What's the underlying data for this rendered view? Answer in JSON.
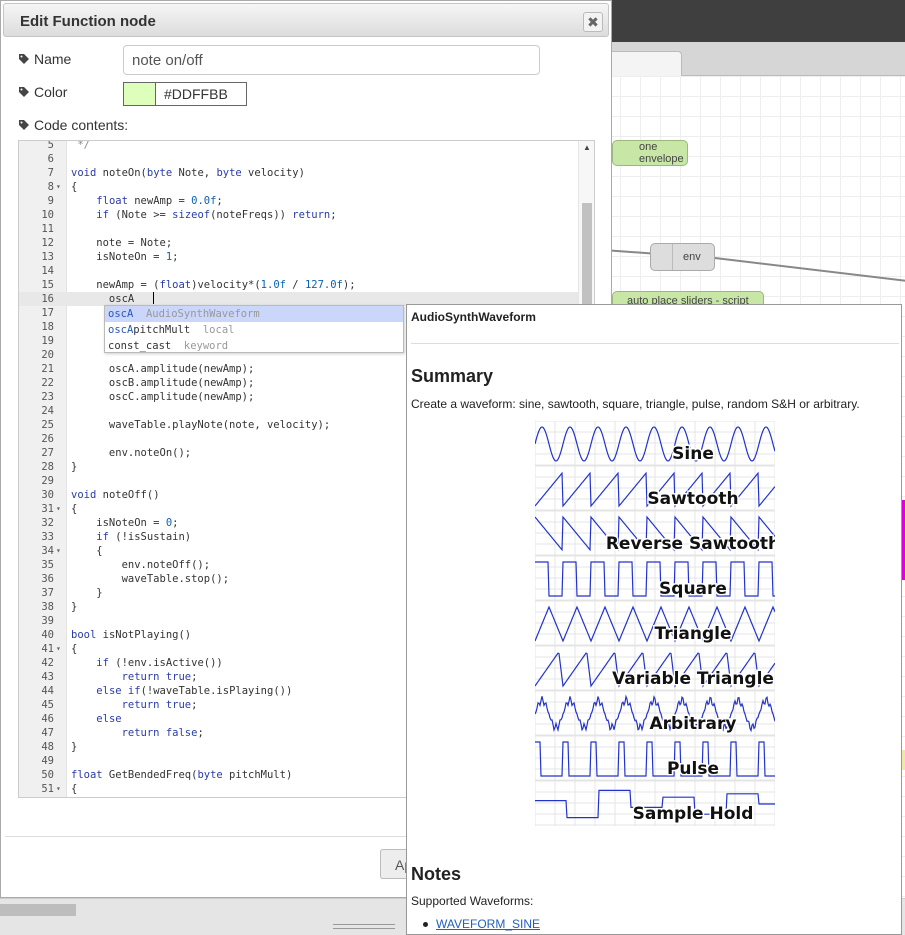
{
  "workspace": {
    "env_label_node": "one envelope",
    "env_node": "env",
    "script_node": "auto place sliders - script"
  },
  "dialog": {
    "title": "Edit Function node",
    "close_glyph": "✖",
    "name_label": "Name",
    "name_value": "note on/off",
    "color_label": "Color",
    "color_value": "#DDFFBB",
    "color_swatch": "#DDFFBB",
    "code_label": "Code contents:",
    "apply_label": "Ap"
  },
  "code_lines": [
    {
      "n": "5",
      "text": " */"
    },
    {
      "n": "6",
      "text": ""
    },
    {
      "n": "7",
      "text": "void noteOn(byte Note, byte velocity)"
    },
    {
      "n": "8",
      "text": "{",
      "fold": true
    },
    {
      "n": "9",
      "text": "    float newAmp = 0.0f;"
    },
    {
      "n": "10",
      "text": "    if (Note >= sizeof(noteFreqs)) return;"
    },
    {
      "n": "11",
      "text": ""
    },
    {
      "n": "12",
      "text": "    note = Note;"
    },
    {
      "n": "13",
      "text": "    isNoteOn = 1;"
    },
    {
      "n": "14",
      "text": ""
    },
    {
      "n": "15",
      "text": "    newAmp = (float)velocity*(1.0f / 127.0f);"
    },
    {
      "n": "16",
      "text": "      oscA",
      "active": true
    },
    {
      "n": "17",
      "text": ""
    },
    {
      "n": "18",
      "text": ""
    },
    {
      "n": "19",
      "text": ""
    },
    {
      "n": "20",
      "text": ""
    },
    {
      "n": "21",
      "text": "      oscA.amplitude(newAmp);"
    },
    {
      "n": "22",
      "text": "      oscB.amplitude(newAmp);"
    },
    {
      "n": "23",
      "text": "      oscC.amplitude(newAmp);"
    },
    {
      "n": "24",
      "text": ""
    },
    {
      "n": "25",
      "text": "      waveTable.playNote(note, velocity);"
    },
    {
      "n": "26",
      "text": ""
    },
    {
      "n": "27",
      "text": "      env.noteOn();"
    },
    {
      "n": "28",
      "text": "}"
    },
    {
      "n": "29",
      "text": ""
    },
    {
      "n": "30",
      "text": "void noteOff()"
    },
    {
      "n": "31",
      "text": "{",
      "fold": true
    },
    {
      "n": "32",
      "text": "    isNoteOn = 0;"
    },
    {
      "n": "33",
      "text": "    if (!isSustain)"
    },
    {
      "n": "34",
      "text": "    {",
      "fold": true
    },
    {
      "n": "35",
      "text": "        env.noteOff();"
    },
    {
      "n": "36",
      "text": "        waveTable.stop();"
    },
    {
      "n": "37",
      "text": "    }"
    },
    {
      "n": "38",
      "text": "}"
    },
    {
      "n": "39",
      "text": ""
    },
    {
      "n": "40",
      "text": "bool isNotPlaying()"
    },
    {
      "n": "41",
      "text": "{",
      "fold": true
    },
    {
      "n": "42",
      "text": "    if (!env.isActive())"
    },
    {
      "n": "43",
      "text": "        return true;"
    },
    {
      "n": "44",
      "text": "    else if(!waveTable.isPlaying())"
    },
    {
      "n": "45",
      "text": "        return true;"
    },
    {
      "n": "46",
      "text": "    else"
    },
    {
      "n": "47",
      "text": "        return false;"
    },
    {
      "n": "48",
      "text": "}"
    },
    {
      "n": "49",
      "text": ""
    },
    {
      "n": "50",
      "text": "float GetBendedFreq(byte pitchMult)"
    },
    {
      "n": "51",
      "text": "{",
      "fold": true
    }
  ],
  "autocomplete": [
    {
      "match": "oscA",
      "rest": "",
      "meta": "AudioSynthWaveform",
      "selected": true
    },
    {
      "match": "oscA",
      "rest": "pitchMult",
      "meta": "local",
      "selected": false
    },
    {
      "match": "",
      "rest": "const_cast",
      "meta": "keyword",
      "selected": false
    }
  ],
  "doc": {
    "title": "AudioSynthWaveform",
    "summary_heading": "Summary",
    "summary_text": "Create a waveform: sine, sawtooth, square, triangle, pulse, random S&H or arbitrary.",
    "waveforms": [
      "Sine",
      "Sawtooth",
      "Reverse Sawtooth",
      "Square",
      "Triangle",
      "Variable Triangle",
      "Arbitrary",
      "Pulse",
      "Sample Hold"
    ],
    "notes_heading": "Notes",
    "notes_text": "Supported Waveforms:",
    "first_link": "WAVEFORM_SINE"
  }
}
